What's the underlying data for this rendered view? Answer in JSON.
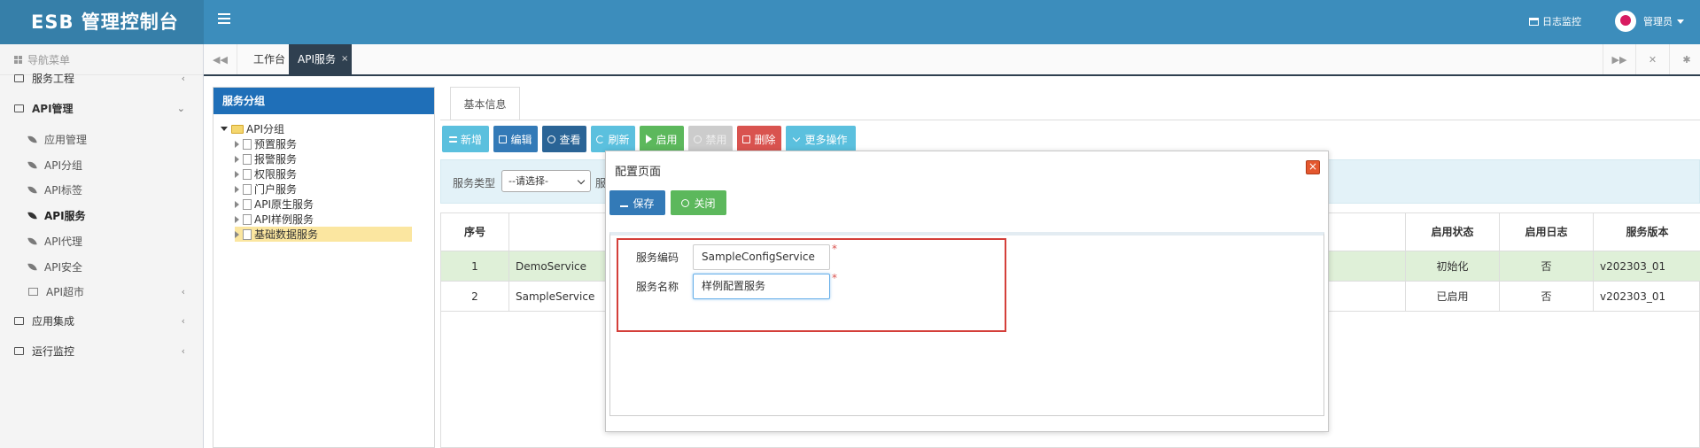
{
  "header": {
    "brand": "ESB 管理控制台",
    "log_monitor": "日志监控",
    "user": "管理员"
  },
  "sidebar": {
    "nav_title": "导航菜单",
    "items": [
      {
        "label": "服务工程",
        "chevron": "‹"
      },
      {
        "label": "API管理",
        "chevron": "⌄"
      },
      {
        "label": "应用管理"
      },
      {
        "label": "API分组"
      },
      {
        "label": "API标签"
      },
      {
        "label": "API服务"
      },
      {
        "label": "API代理"
      },
      {
        "label": "API安全"
      },
      {
        "label": "API超市",
        "chevron": "‹"
      },
      {
        "label": "应用集成",
        "chevron": "‹"
      },
      {
        "label": "运行监控",
        "chevron": "‹"
      }
    ]
  },
  "tabs": {
    "workbench": "工作台",
    "api_service": "API服务",
    "close_mark": "×"
  },
  "tree": {
    "title": "服务分组",
    "root": "API分组",
    "children": [
      "预置服务",
      "报警服务",
      "权限服务",
      "门户服务",
      "API原生服务",
      "API样例服务",
      "基础数据服务"
    ]
  },
  "main": {
    "tab_label": "基本信息",
    "toolbar": {
      "add": "新增",
      "edit": "编辑",
      "view": "查看",
      "refresh": "刷新",
      "enable": "启用",
      "disable": "禁用",
      "delete": "删除",
      "more": "更多操作"
    },
    "search": {
      "label": "服务类型",
      "select_value": "--请选择-",
      "label_fragment": "服"
    },
    "grid": {
      "columns": [
        "序号",
        "",
        "启用状态",
        "启用日志",
        "服务版本"
      ],
      "rows": [
        {
          "no": "1",
          "name": "DemoService",
          "status": "初始化",
          "log": "否",
          "version": "v202303_01"
        },
        {
          "no": "2",
          "name": "SampleService",
          "status": "已启用",
          "log": "否",
          "version": "v202303_01"
        }
      ]
    }
  },
  "modal": {
    "title": "配置页面",
    "close_glyph": "×",
    "save": "保存",
    "close": "关闭",
    "fields": [
      {
        "label": "服务编码",
        "value": "SampleConfigService"
      },
      {
        "label": "服务名称",
        "value": "样例配置服务"
      }
    ],
    "required_mark": "*"
  },
  "colors": {
    "header": "#3c8dbc",
    "brand": "#367fa9",
    "tab_active": "#2f4050",
    "tree_header": "#1f6fb8",
    "highlight_row": "#dff0d8",
    "tree_selected": "#fbe6a0",
    "required_box": "#d43f3a"
  }
}
